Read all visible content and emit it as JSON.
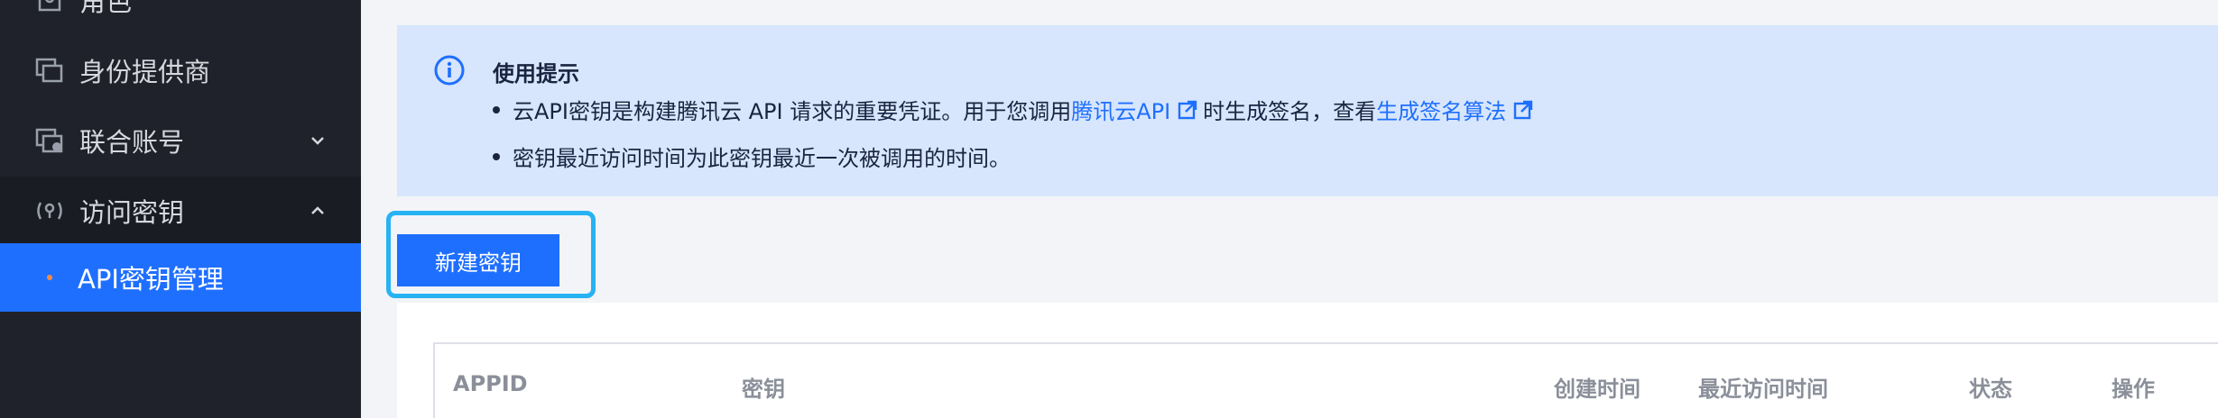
{
  "sidebar": {
    "items": [
      {
        "label": "角色",
        "icon": "role-icon"
      },
      {
        "label": "身份提供商",
        "icon": "identity-provider-icon"
      },
      {
        "label": "联合账号",
        "icon": "federated-account-icon"
      },
      {
        "label": "访问密钥",
        "icon": "access-key-icon"
      }
    ],
    "active_sub_item": "API密钥管理"
  },
  "notice": {
    "title": "使用提示",
    "tip1": {
      "prefix": "云API密钥是构建腾讯云 API 请求的重要凭证。用于您调用",
      "link1": "腾讯云API",
      "middle": "时生成签名，查看",
      "link2": "生成签名算法"
    },
    "tip2": "密钥最近访问时间为此密钥最近一次被调用的时间。"
  },
  "toolbar": {
    "create_label": "新建密钥"
  },
  "table": {
    "columns": [
      "APPID",
      "密钥",
      "创建时间",
      "最近访问时间",
      "状态",
      "操作"
    ]
  },
  "colors": {
    "sidebar_bg": "#1f222b",
    "active_blue": "#1f6fff",
    "notice_bg": "#d7e6fc",
    "highlight": "#27b2f2"
  }
}
